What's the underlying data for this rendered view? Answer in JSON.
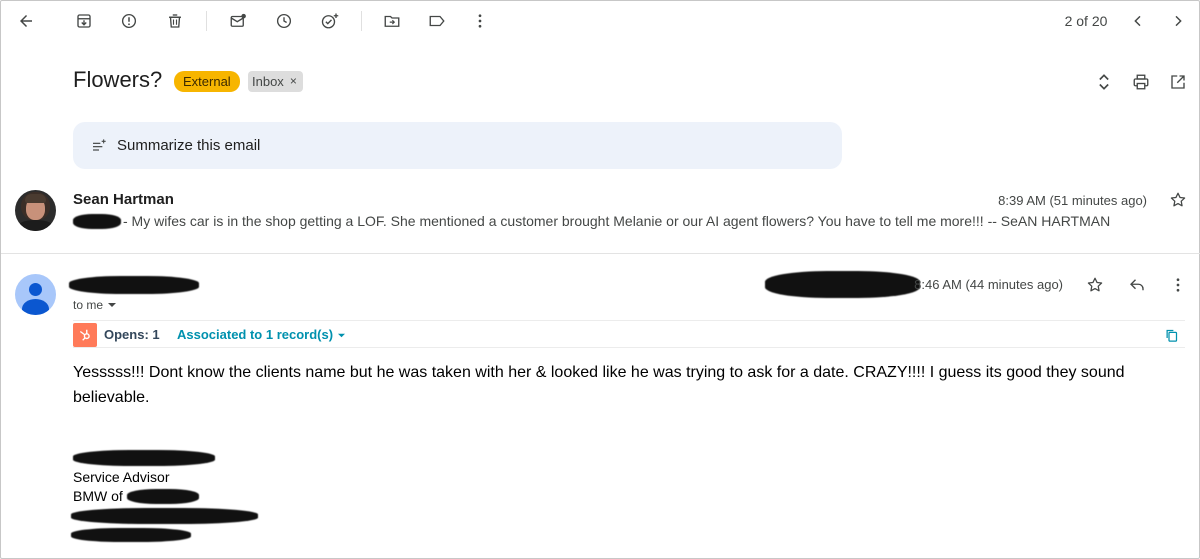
{
  "toolbar": {
    "icons": [
      "back-arrow-icon",
      "archive-icon",
      "report-spam-icon",
      "delete-icon",
      "mark-unread-icon",
      "snooze-icon",
      "add-task-icon",
      "move-to-icon",
      "label-icon",
      "more-vert-icon"
    ],
    "pager": "2 of 20"
  },
  "email": {
    "subject": "Flowers?",
    "labels": {
      "external": "External",
      "inbox": "Inbox",
      "inbox_remove": "×"
    }
  },
  "summarize": {
    "label": "Summarize this email"
  },
  "message1": {
    "sender": "Sean Hartman",
    "snippet": "- My wifes car is in the shop getting a LOF. She mentioned a customer brought Melanie or our AI agent flowers? You have to tell me more!!! -- SeAN HARTMAN",
    "time": "8:39 AM (51 minutes ago)"
  },
  "message2": {
    "to": "to me",
    "time": "8:46 AM (44 minutes ago)",
    "hubspot": {
      "opens": "Opens: 1",
      "associated": "Associated to 1 record(s)"
    },
    "body": "Yesssss!!! Dont know the clients name but he was taken with her & looked like he was trying to ask for a date. CRAZY!!!! I guess its good they sound believable.",
    "signature": {
      "title": "Service Advisor",
      "company_prefix": "BMW of"
    }
  },
  "colors": {
    "external_label": "#f7b500",
    "inbox_label": "#dddddd",
    "summarize_bg": "#edf2fa",
    "hubspot_orange": "#ff7a59",
    "hubspot_link": "#0091ae",
    "avatar_blue": "#a8c7fa"
  }
}
